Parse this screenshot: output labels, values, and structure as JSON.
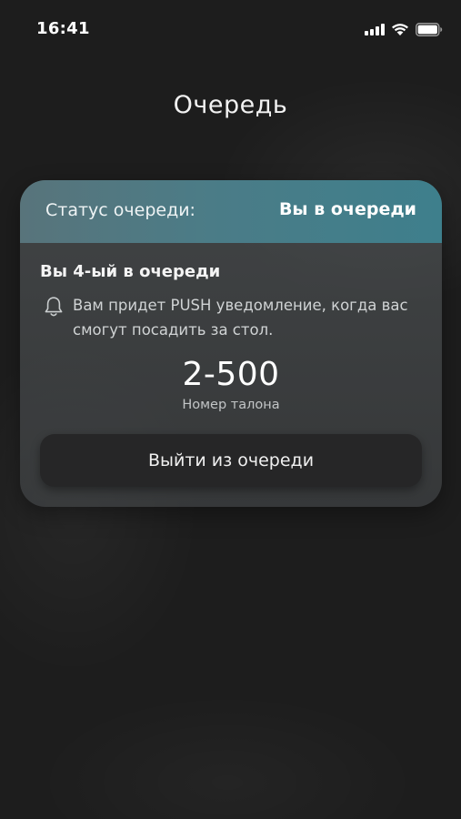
{
  "status_bar": {
    "time": "16:41",
    "icons": [
      "signal-icon",
      "wifi-icon",
      "battery-icon"
    ]
  },
  "header": {
    "title": "Очередь"
  },
  "queue_card": {
    "status_label": "Статус очереди:",
    "status_value": "Вы в очереди",
    "position_text": "Вы 4-ый в очереди",
    "notice_icon": "bell-icon",
    "notice_text": "Вам придет PUSH уведомление, когда вас смогут посадить за стол.",
    "ticket_number": "2-500",
    "ticket_caption": "Номер талона",
    "leave_button_label": "Выйти из очереди"
  },
  "colors": {
    "background": "#1d1d1d",
    "header_gradient_start": "#58747b",
    "header_gradient_end": "#3e7f8c",
    "button_background": "#262627"
  }
}
